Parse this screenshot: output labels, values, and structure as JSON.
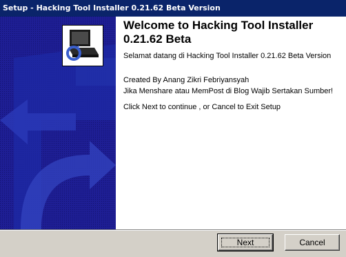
{
  "window": {
    "title": "Setup - Hacking Tool Installer 0.21.62 Beta Version"
  },
  "welcome": {
    "heading": "Welcome to Hacking Tool Installer 0.21.62 Beta",
    "greeting": "Selamat datang di Hacking Tool Installer 0.21.62 Beta Version",
    "credit": "Created By Anang Zikri Febriyansyah",
    "notice": "Jika Menshare atau MemPost di Blog Wajib Sertakan Sumber!",
    "instruction": "Click Next to continue , or Cancel to Exit Setup"
  },
  "buttons": {
    "next": "Next",
    "cancel": "Cancel"
  },
  "icons": {
    "wizard": "computer-install-icon"
  },
  "colors": {
    "titlebar": "#0a246a",
    "side_panel": "#1a1a8a",
    "dialog_bg": "#d4d0c8"
  }
}
